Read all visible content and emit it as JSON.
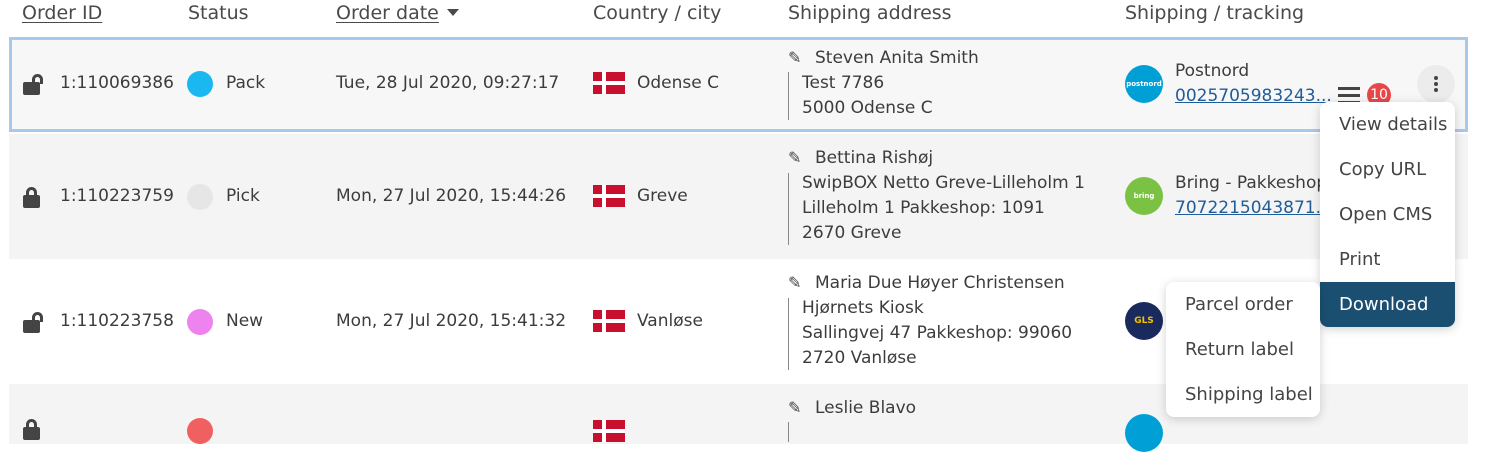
{
  "columns": {
    "order_id": "Order ID",
    "status": "Status",
    "order_date": "Order date",
    "country_city": "Country / city",
    "shipping_address": "Shipping address",
    "shipping_tracking": "Shipping / tracking"
  },
  "rows": [
    {
      "order_id": "1:110069386",
      "status": "Pack",
      "status_color": "#1ab8f0",
      "date": "Tue, 28 Jul 2020, 09:27:17",
      "city": "Odense C",
      "address": [
        "Steven Anita Smith",
        "Test 7786",
        "5000 Odense C"
      ],
      "carrier_logo": "postnord",
      "carrier_color": "#00a0d6",
      "carrier": "Postnord",
      "tracking": "0025705983243...",
      "badge": "10"
    },
    {
      "order_id": "1:110223759",
      "status": "Pick",
      "status_color": "#e6e6e6",
      "date": "Mon, 27 Jul 2020, 15:44:26",
      "city": "Greve",
      "address": [
        "Bettina Rishøj",
        "SwipBOX Netto Greve-Lilleholm 1",
        "Lilleholm 1 Pakkeshop: 1091",
        "2670 Greve"
      ],
      "carrier_logo": "bring",
      "carrier_color": "#7bc144",
      "carrier": "Bring - Pakkeshop",
      "tracking": "7072215043871..."
    },
    {
      "order_id": "1:110223758",
      "status": "New",
      "status_color": "#ee82ee",
      "date": "Mon, 27 Jul 2020, 15:41:32",
      "city": "Vanløse",
      "address": [
        "Maria Due Høyer Christensen",
        "Hjørnets Kiosk",
        "Sallingvej 47 Pakkeshop: 99060",
        "2720 Vanløse"
      ],
      "carrier_logo": "GLS",
      "carrier_color": "#1a2a5c"
    },
    {
      "address": [
        "Leslie Blavo"
      ],
      "status_color": "#f06060",
      "carrier_color": "#00a0d6"
    }
  ],
  "row_menu": [
    "View details",
    "Copy URL",
    "Open CMS",
    "Print",
    "Download"
  ],
  "download_submenu": [
    "Parcel order",
    "Return label",
    "Shipping label"
  ],
  "colors": {
    "menu_active": "#1b4f72",
    "selection_outline": "#a9c9ea"
  }
}
